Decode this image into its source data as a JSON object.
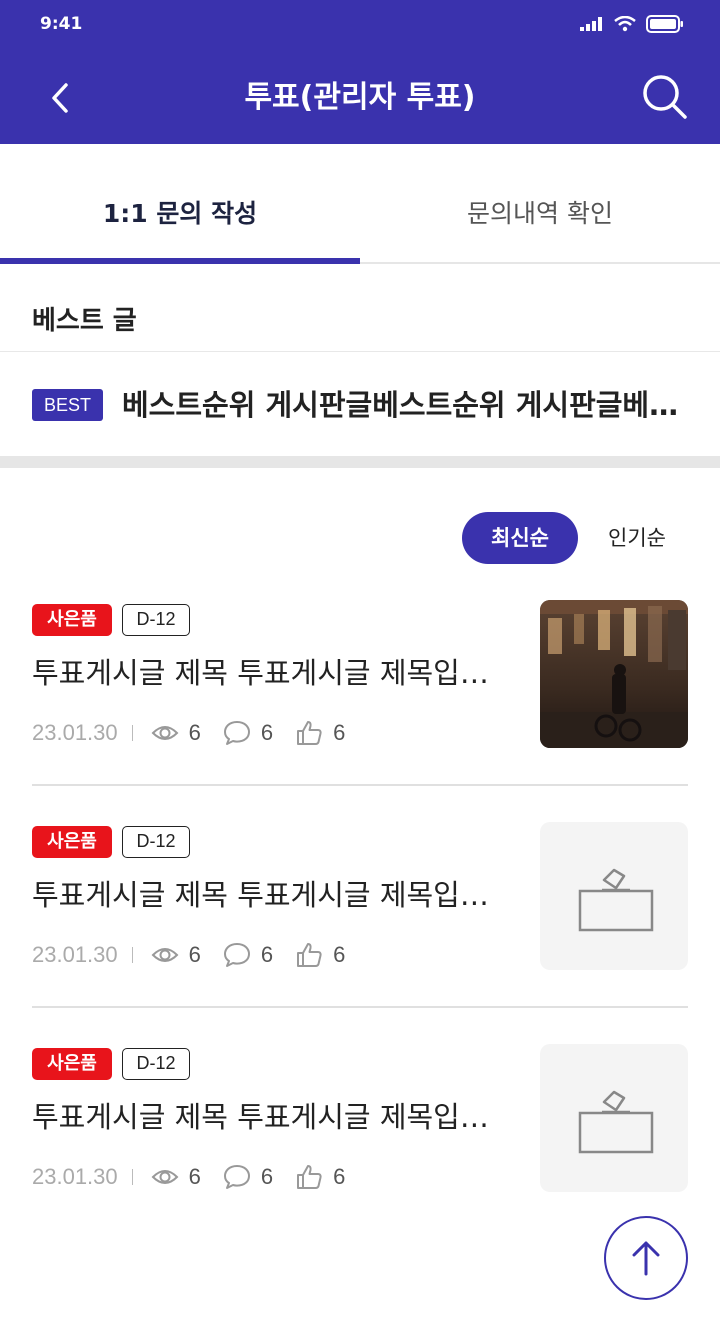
{
  "status_bar": {
    "time": "9:41"
  },
  "header": {
    "title": "투표(관리자 투표)"
  },
  "tabs": [
    {
      "label": "1:1 문의 작성",
      "active": true
    },
    {
      "label": "문의내역 확인",
      "active": false
    }
  ],
  "best": {
    "section_title": "베스트 글",
    "badge": "BEST",
    "text": "베스트순위 게시판글베스트순위 게시판글베스트순위 게시판글"
  },
  "sort": {
    "latest": "최신순",
    "popular": "인기순"
  },
  "posts": [
    {
      "tag": "사은품",
      "dday": "D-12",
      "title": "투표게시글 제목 투표게시글 제목입니다",
      "date": "23.01.30",
      "views": "6",
      "comments": "6",
      "likes": "6",
      "thumb": "photo"
    },
    {
      "tag": "사은품",
      "dday": "D-12",
      "title": "투표게시글 제목 투표게시글 제목입니다",
      "date": "23.01.30",
      "views": "6",
      "comments": "6",
      "likes": "6",
      "thumb": "ballot-box-icon"
    },
    {
      "tag": "사은품",
      "dday": "D-12",
      "title": "투표게시글 제목 투표게시글 제목입니다",
      "date": "23.01.30",
      "views": "6",
      "comments": "6",
      "likes": "6",
      "thumb": "ballot-box-icon"
    }
  ],
  "colors": {
    "primary": "#3a32ad",
    "gift_tag": "#e8141b"
  }
}
